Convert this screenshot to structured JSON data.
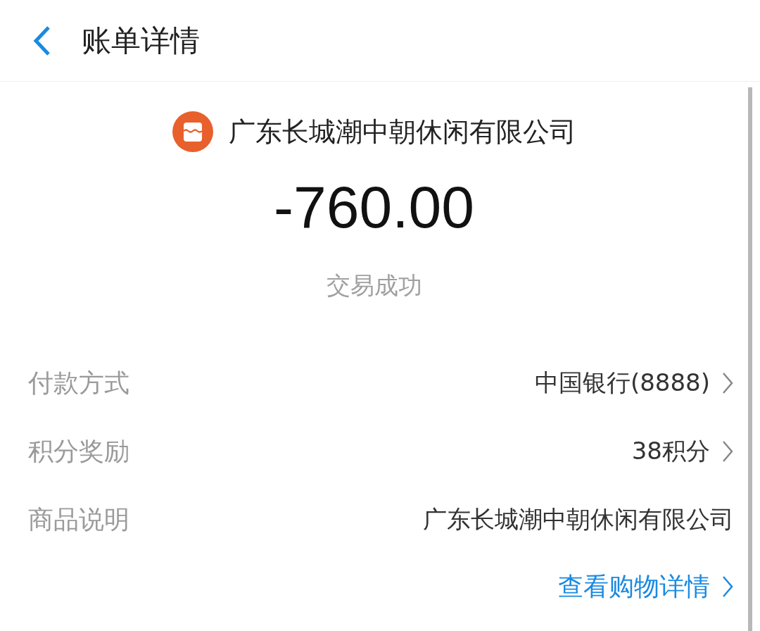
{
  "header": {
    "title": "账单详情"
  },
  "merchant": {
    "name": "广东长城潮中朝休闲有限公司"
  },
  "amount": "-760.00",
  "status": "交易成功",
  "rows": [
    {
      "kind": "nav",
      "label": "付款方式",
      "value": "中国银行(8888)"
    },
    {
      "kind": "nav",
      "label": "积分奖励",
      "value": "38积分"
    },
    {
      "kind": "plain",
      "label": "商品说明",
      "value": "广东长城潮中朝休闲有限公司"
    },
    {
      "kind": "link",
      "value": "查看购物详情"
    }
  ]
}
